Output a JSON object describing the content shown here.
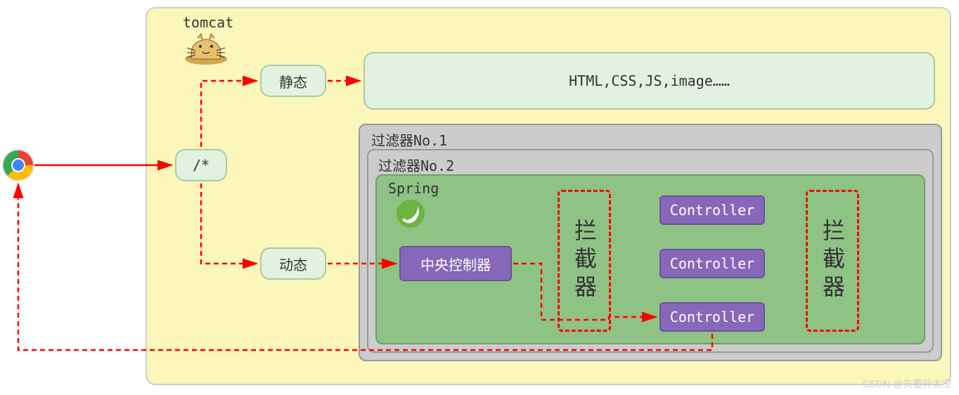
{
  "container": {
    "label": "tomcat"
  },
  "router": {
    "label": "/*"
  },
  "staticBranch": {
    "label": "静态",
    "content": "HTML,CSS,JS,image……"
  },
  "dynamicBranch": {
    "label": "动态"
  },
  "filters": {
    "outer": "过滤器No.1",
    "inner": "过滤器No.2"
  },
  "spring": {
    "label": "Spring",
    "dispatcher": "中央控制器",
    "interceptor": "拦截器",
    "controllers": [
      "Controller",
      "Controller",
      "Controller"
    ]
  },
  "watermark": "CSDN @失重外太空."
}
